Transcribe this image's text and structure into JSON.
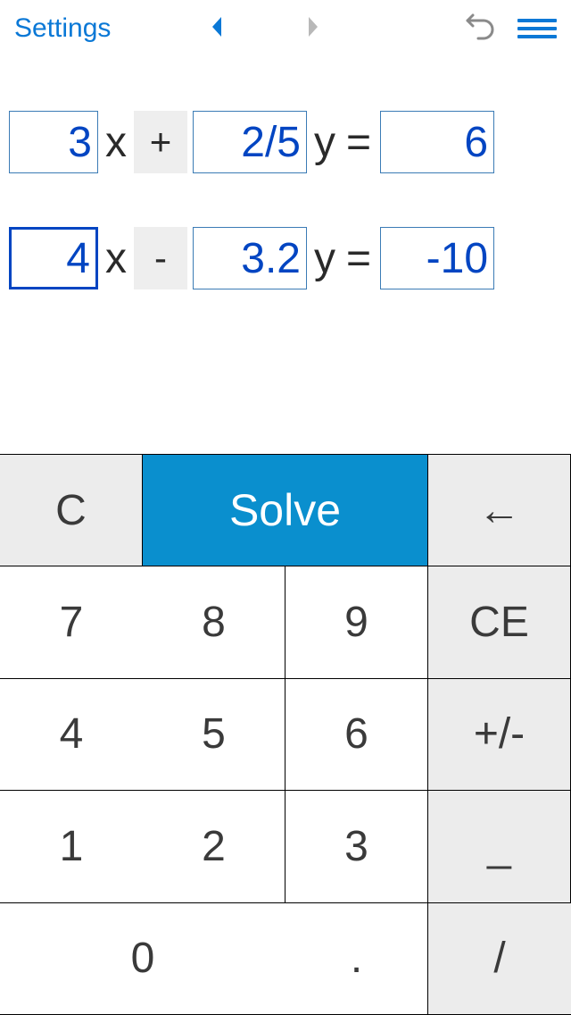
{
  "header": {
    "settings_label": "Settings"
  },
  "equations": [
    {
      "coef_x": "3",
      "coef_y": "2/5",
      "op": "+",
      "rhs": "6",
      "active": false
    },
    {
      "coef_x": "4",
      "coef_y": "3.2",
      "op": "-",
      "rhs": "-10",
      "active": true
    }
  ],
  "labels": {
    "x": "x",
    "y": "y",
    "equals": "="
  },
  "keypad": {
    "clear": "C",
    "solve": "Solve",
    "backspace": "←",
    "ce": "CE",
    "plusminus": "+/-",
    "underscore": "_",
    "dot": ".",
    "slash": "/",
    "k7": "7",
    "k8": "8",
    "k9": "9",
    "k4": "4",
    "k5": "5",
    "k6": "6",
    "k1": "1",
    "k2": "2",
    "k3": "3",
    "k0": "0"
  }
}
